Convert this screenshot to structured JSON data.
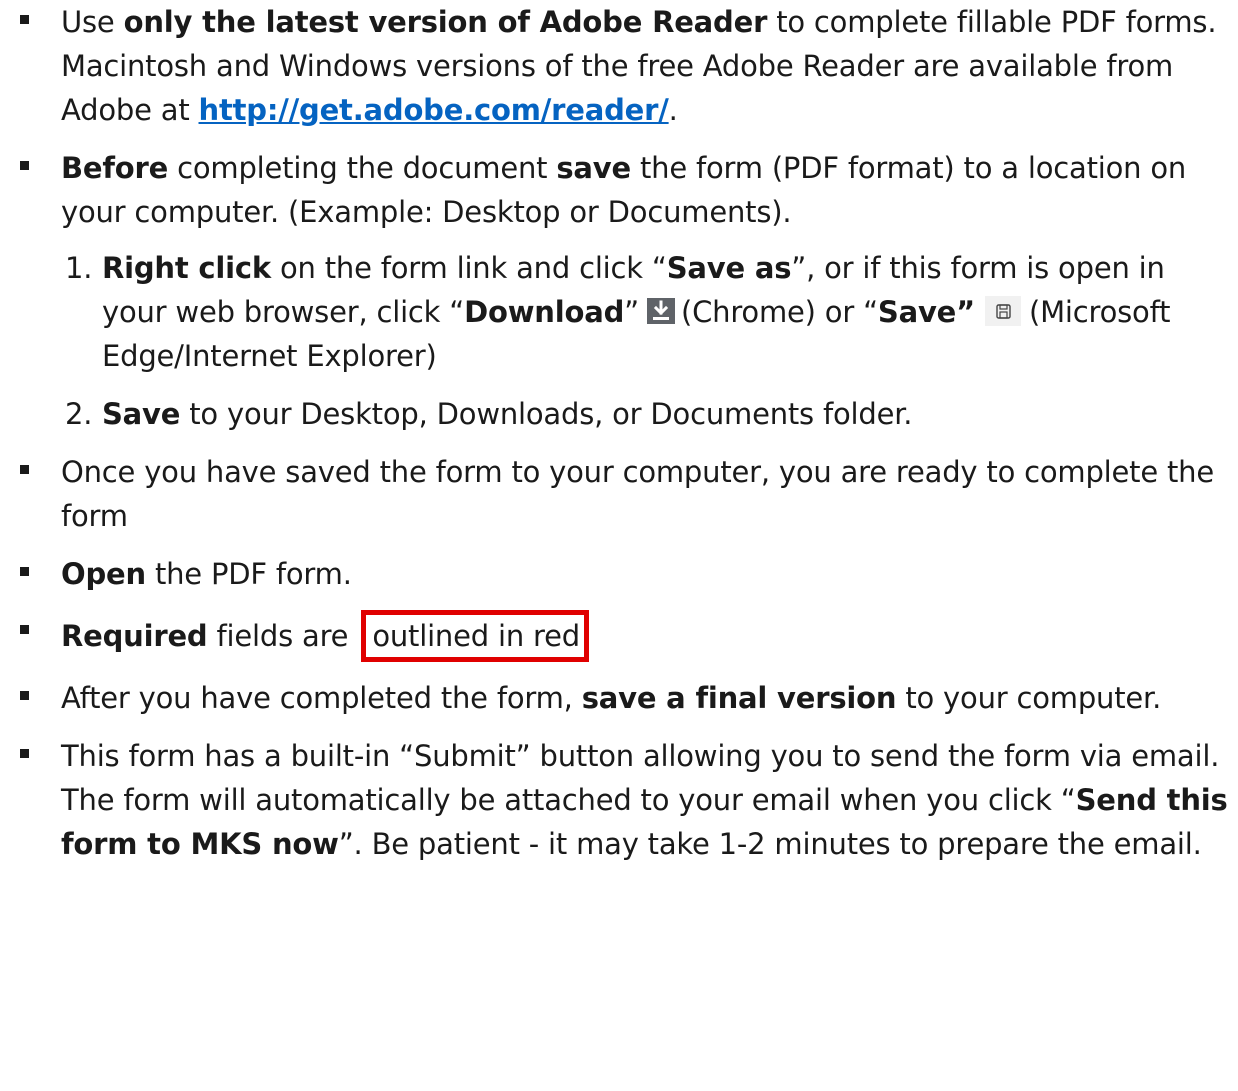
{
  "items": {
    "b1": {
      "t1": "Use ",
      "b1": "only the latest version of Adobe Reader",
      "t2": " to complete fillable PDF forms. Macintosh and Windows versions of the free Adobe Reader are available from Adobe at ",
      "link": "http://get.adobe.com/reader/",
      "t3": "."
    },
    "b2": {
      "b1": "Before",
      "t1": " completing the document ",
      "b2": "save",
      "t2": " the form (PDF format) to a location on your computer. (Example: Desktop or Documents).",
      "steps": {
        "s1": {
          "num": "1.",
          "b1": "Right click",
          "t1": " on the form link and click “",
          "b2": "Save as",
          "t2": "”, or if this form is open in your web browser, click “",
          "b3": "Download",
          "t3": "”",
          "t4": "(Chrome) or “",
          "b4": "Save”",
          "t5": "(Microsoft Edge/Internet Explorer)"
        },
        "s2": {
          "num": "2.",
          "b1": "Save",
          "t1": " to your Desktop, Downloads, or Documents folder."
        }
      }
    },
    "b3": {
      "t1": "Once you have saved the form to your computer, you are ready to complete the form"
    },
    "b4": {
      "b1": "Open",
      "t1": " the PDF form."
    },
    "b5": {
      "b1": "Required",
      "t1": " fields are ",
      "boxed": "outlined in red"
    },
    "b6": {
      "t1": "After you have completed the form, ",
      "b1": "save a final version",
      "t2": " to your computer."
    },
    "b7": {
      "t1": "This form has a built-in “Submit” button allowing you to send the form via email. The form will automatically be attached to your email when you click “",
      "b1": "Send this form to MKS now",
      "t2": "”. Be patient - it may take 1-2 minutes to prepare the email."
    }
  },
  "icons": {
    "download": "download-icon",
    "save": "floppy-disk-icon"
  },
  "colors": {
    "link": "#0563c1",
    "outline": "#e00000",
    "text": "#1a1a1a"
  }
}
